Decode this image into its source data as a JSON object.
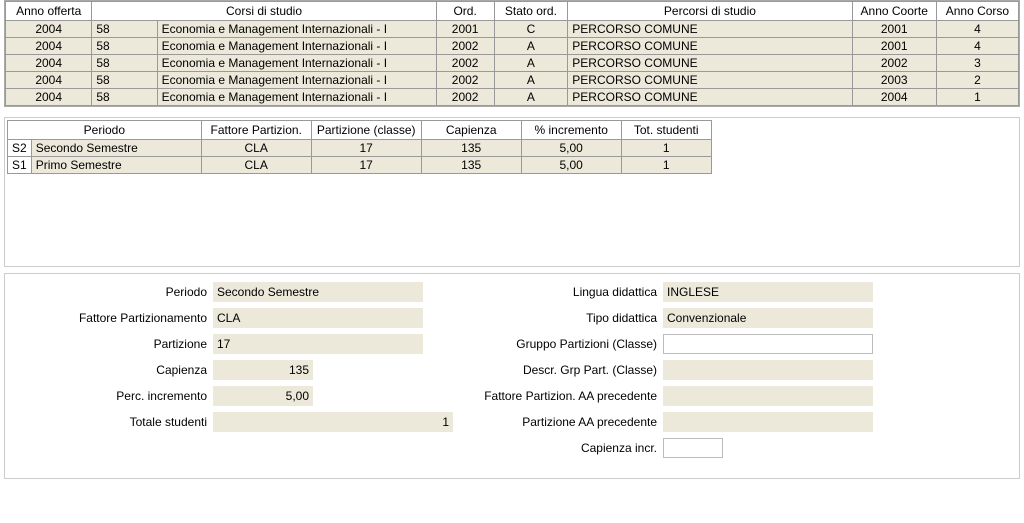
{
  "top_table": {
    "headers": {
      "anno_offerta": "Anno offerta",
      "corsi_studio": "Corsi di studio",
      "ord": "Ord.",
      "stato_ord": "Stato ord.",
      "percorsi_studio": "Percorsi di studio",
      "anno_coorte": "Anno Coorte",
      "anno_corso": "Anno Corso"
    },
    "rows": [
      {
        "anno_off": "2004",
        "cod": "58",
        "titolo": "Economia e Management Internazionali - I",
        "ord": "2001",
        "stato": "C",
        "perc": "PERCORSO COMUNE",
        "coorte": "2001",
        "corso": "4"
      },
      {
        "anno_off": "2004",
        "cod": "58",
        "titolo": "Economia e Management Internazionali - I",
        "ord": "2002",
        "stato": "A",
        "perc": "PERCORSO COMUNE",
        "coorte": "2001",
        "corso": "4"
      },
      {
        "anno_off": "2004",
        "cod": "58",
        "titolo": "Economia e Management Internazionali - I",
        "ord": "2002",
        "stato": "A",
        "perc": "PERCORSO COMUNE",
        "coorte": "2002",
        "corso": "3"
      },
      {
        "anno_off": "2004",
        "cod": "58",
        "titolo": "Economia e Management Internazionali - I",
        "ord": "2002",
        "stato": "A",
        "perc": "PERCORSO COMUNE",
        "coorte": "2003",
        "corso": "2"
      },
      {
        "anno_off": "2004",
        "cod": "58",
        "titolo": "Economia e Management Internazionali - I",
        "ord": "2002",
        "stato": "A",
        "perc": "PERCORSO COMUNE",
        "coorte": "2004",
        "corso": "1"
      }
    ]
  },
  "mid_table": {
    "headers": {
      "periodo": "Periodo",
      "fattore": "Fattore Partizion.",
      "partizione": "Partizione (classe)",
      "capienza": "Capienza",
      "incremento": "% incremento",
      "tot": "Tot. studenti"
    },
    "rows": [
      {
        "code": "S2",
        "periodo": "Secondo Semestre",
        "fattore": "CLA",
        "part": "17",
        "cap": "135",
        "inc": "5,00",
        "tot": "1"
      },
      {
        "code": "S1",
        "periodo": "Primo Semestre",
        "fattore": "CLA",
        "part": "17",
        "cap": "135",
        "inc": "5,00",
        "tot": "1"
      }
    ]
  },
  "detail": {
    "labels": {
      "periodo": "Periodo",
      "fattore_part": "Fattore Partizionamento",
      "partizione": "Partizione",
      "capienza": "Capienza",
      "perc_inc": "Perc. incremento",
      "tot_studenti": "Totale studenti",
      "lingua": "Lingua didattica",
      "tipo_did": "Tipo didattica",
      "grp_part_classe": "Gruppo Partizioni (Classe)",
      "descr_grp": "Descr. Grp Part. (Classe)",
      "fatt_aa_prec": "Fattore Partizion. AA precedente",
      "part_aa_prec": "Partizione AA precedente",
      "cap_incr": "Capienza incr."
    },
    "values": {
      "periodo": "Secondo Semestre",
      "fattore_part": "CLA",
      "partizione": "17",
      "capienza": "135",
      "perc_inc": "5,00",
      "tot_studenti": "1",
      "lingua": "INGLESE",
      "tipo_did": "Convenzionale",
      "grp_part_classe": "",
      "descr_grp": "",
      "fatt_aa_prec": "",
      "part_aa_prec": "",
      "cap_incr": ""
    }
  }
}
